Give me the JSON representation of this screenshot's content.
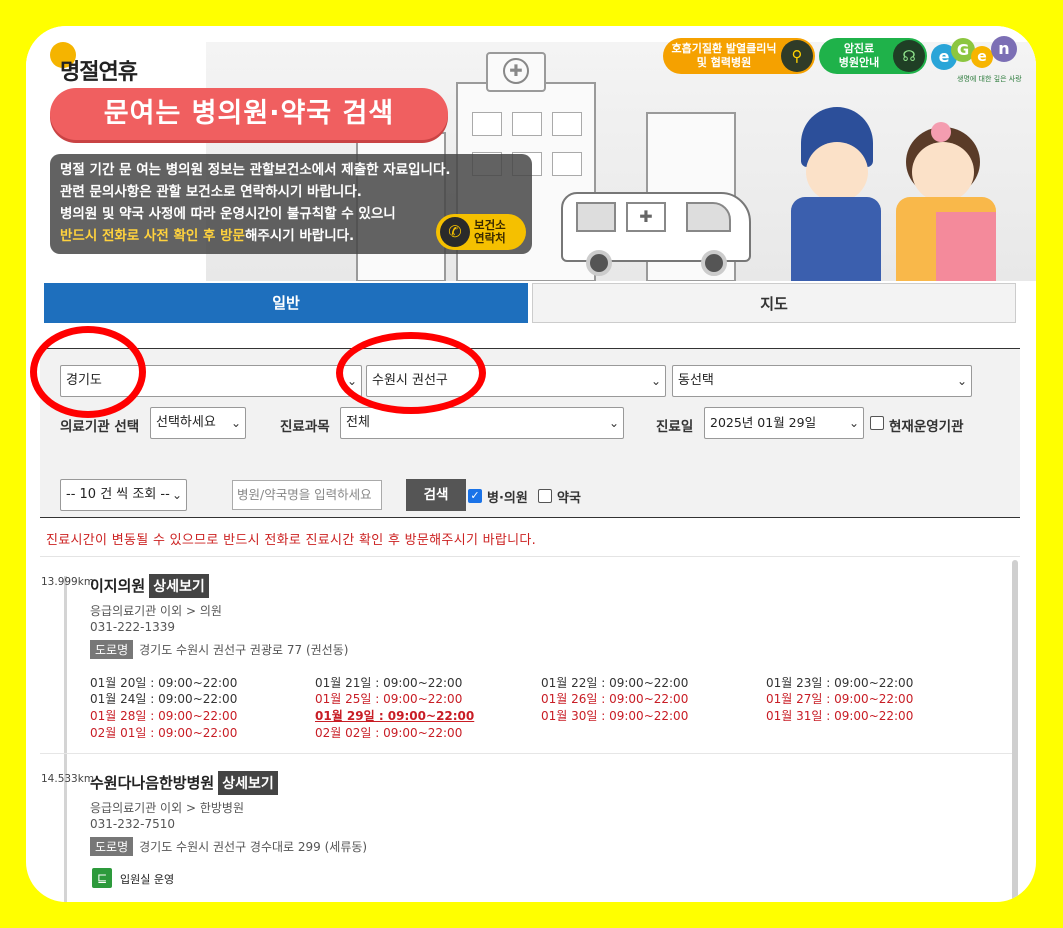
{
  "banner": {
    "brand": "명절연휴",
    "title": "문여는 병의원·약국 검색",
    "notice_lines": [
      "명절 기간 문 여는 병의원 정보는 관할보건소에서 제출한 자료입니다.",
      "관련 문의사항은 관할 보건소로 연락하시기 바랍니다.",
      "병의원 및 약국 사정에 따라 운영시간이 불규칙할 수 있으니"
    ],
    "notice_highlight": "반드시 전화로 사전 확인 후 방문",
    "notice_tail": "해주시기 바랍니다.",
    "phone_badge": [
      "보건소",
      "연락처"
    ],
    "btn_fever": [
      "호흡기질환 발열클리닉",
      "및 협력병원"
    ],
    "btn_cancer": [
      "암진료",
      "병원안내"
    ],
    "egen_tagline": "생명에 대한 깊은 사랑",
    "colors": {
      "yellow": "#ffff00",
      "accent_red": "#f05f60",
      "tab_blue": "#1e6fbd",
      "annotation_red": "#ff0000"
    }
  },
  "tabs": {
    "general": "일반",
    "map": "지도"
  },
  "search": {
    "province": "경기도",
    "city": "수원시 권선구",
    "dong": "동선택",
    "facility_label": "의료기관 선택",
    "facility_value": "선택하세요",
    "dept_label": "진료과목",
    "dept_value": "전체",
    "date_label": "진료일",
    "date_value": "2025년 01월 29일",
    "open_now_label": "현재운영기관",
    "page_size": "-- 10 건 씩 조회 --",
    "name_placeholder": "병원/약국명을 입력하세요",
    "search_btn": "검색",
    "hospital_label": "병·의원",
    "pharmacy_label": "약국"
  },
  "warning": "진료시간이 변동될 수 있으므로 반드시 전화로 진료시간 확인 후 방문해주시기 바랍니다.",
  "road_label": "도로명",
  "detail_label": "상세보기",
  "results": [
    {
      "distance": "13.999km",
      "name": "이지의원",
      "category": "응급의료기관 이외 > 의원",
      "phone": "031-222-1339",
      "address": "경기도 수원시 권선구 권광로 77 (권선동)",
      "hours": [
        [
          "01월 20일 : 09:00~22:00",
          "01월 21일 : 09:00~22:00",
          "01월 22일 : 09:00~22:00",
          "01월 23일 : 09:00~22:00"
        ],
        [
          "01월 24일 : 09:00~22:00",
          "01월 25일 : 09:00~22:00",
          "01월 26일 : 09:00~22:00",
          "01월 27일 : 09:00~22:00"
        ],
        [
          "01월 28일 : 09:00~22:00",
          "01월 29일 : 09:00~22:00",
          "01월 30일 : 09:00~22:00",
          "01월 31일 : 09:00~22:00"
        ],
        [
          "02월 01일 : 09:00~22:00",
          "02월 02일 : 09:00~22:00"
        ]
      ]
    },
    {
      "distance": "14.533km",
      "name": "수원다나음한방병원",
      "category": "응급의료기관 이외 > 한방병원",
      "phone": "031-232-7510",
      "address": "경기도 수원시 권선구 경수대로 299 (세류동)",
      "inpatient": "입원실 운영"
    }
  ]
}
